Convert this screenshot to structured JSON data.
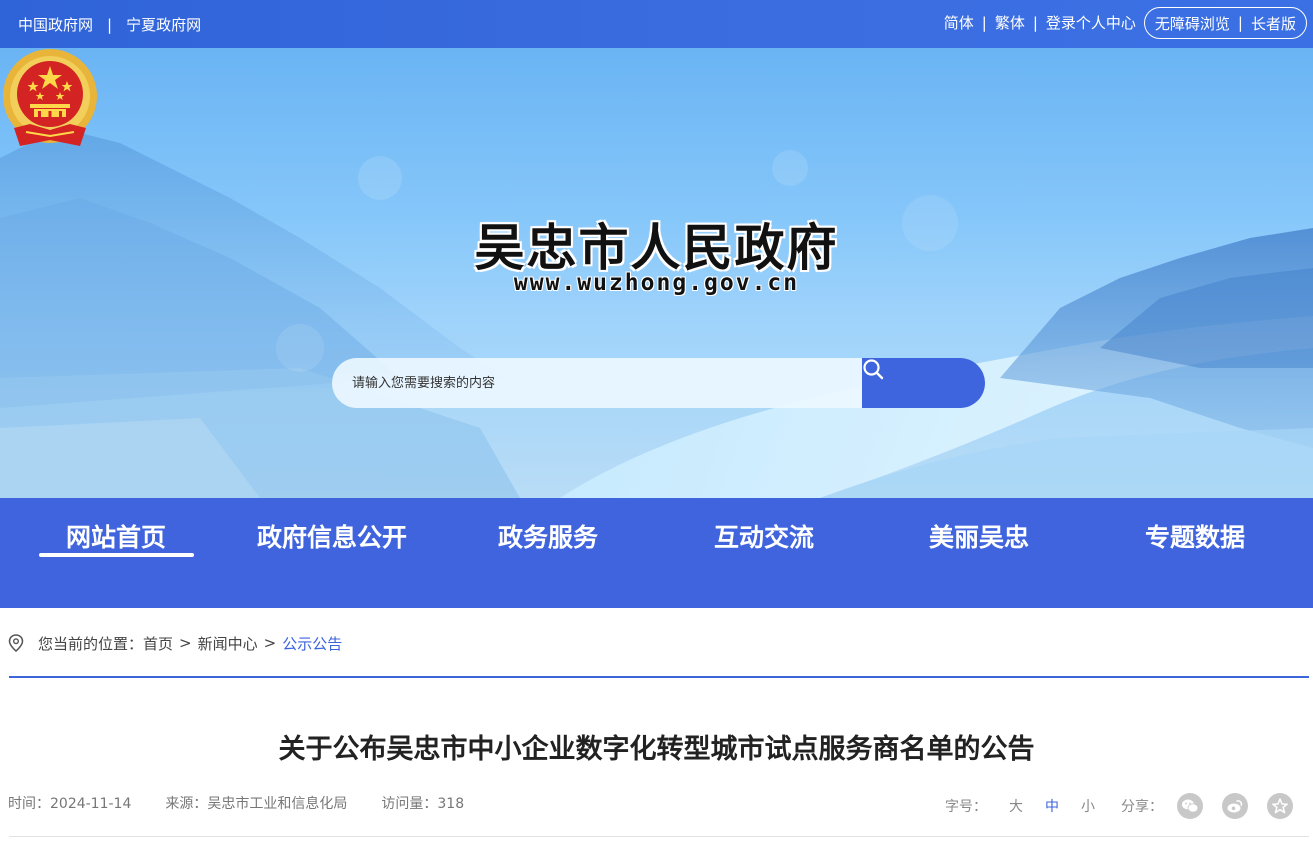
{
  "topbar": {
    "left_links": [
      "中国政府网",
      "宁夏政府网"
    ],
    "left_separator": "|",
    "right_links": [
      "简体",
      "繁体",
      "登录个人中心"
    ],
    "accessibility_links": [
      "无障碍浏览",
      "长者版"
    ],
    "right_separator": "|"
  },
  "banner": {
    "site_name": "吴忠市人民政府",
    "site_url": "www.wuzhong.gov.cn",
    "search_placeholder": "请输入您需要搜索的内容"
  },
  "nav": {
    "items": [
      "网站首页",
      "政府信息公开",
      "政务服务",
      "互动交流",
      "美丽吴忠",
      "专题数据"
    ],
    "active_index": 0
  },
  "breadcrumb": {
    "prefix": "您当前的位置：",
    "items": [
      "首页",
      "新闻中心",
      "公示公告"
    ],
    "separator": ">"
  },
  "article": {
    "title": "关于公布吴忠市中小企业数字化转型城市试点服务商名单的公告",
    "time": "时间：2024-11-14",
    "source": "来源：吴忠市工业和信息化局",
    "views": "访问量：318"
  },
  "tools": {
    "font_size_label": "字号：",
    "sizes": [
      "大",
      "中",
      "小"
    ],
    "active_size": "中",
    "share_label": "分享：",
    "share_icons": [
      "wechat-icon",
      "weibo-icon",
      "favorite-star-icon"
    ]
  },
  "colors": {
    "primary_blue": "#3f64de",
    "topbar_blue": "#3366db",
    "link_blue": "#3b64dc"
  }
}
